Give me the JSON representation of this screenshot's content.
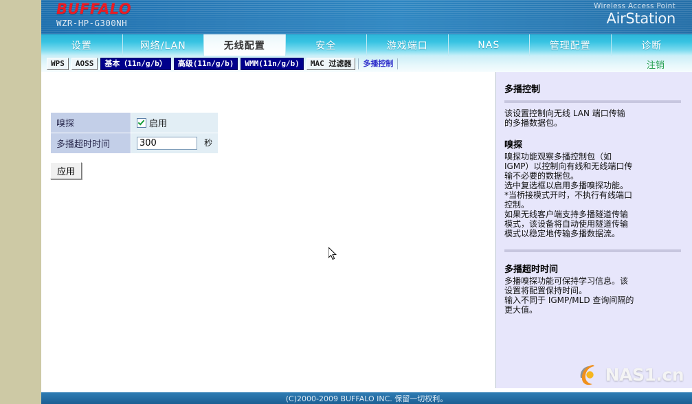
{
  "header": {
    "brand": "BUFFALO",
    "model": "WZR-HP-G300NH",
    "product_sub": "Wireless Access Point",
    "product_name": "AirStation"
  },
  "nav": {
    "tabs": [
      {
        "label": "设置",
        "active": false
      },
      {
        "label": "网络/LAN",
        "active": false
      },
      {
        "label": "无线配置",
        "active": true
      },
      {
        "label": "安全",
        "active": false
      },
      {
        "label": "游戏端口",
        "active": false
      },
      {
        "label": "NAS",
        "active": false
      },
      {
        "label": "管理配置",
        "active": false
      },
      {
        "label": "诊断",
        "active": false
      }
    ]
  },
  "subnav": {
    "tabs": [
      {
        "label": "WPS",
        "style": "plain"
      },
      {
        "label": "AOSS",
        "style": "plain"
      },
      {
        "label": "基本（11n/g/b）",
        "style": "dark"
      },
      {
        "label": "高级(11n/g/b)",
        "style": "dark"
      },
      {
        "label": "WMM(11n/g/b)",
        "style": "dark"
      },
      {
        "label": "MAC 过滤器",
        "style": "plain"
      },
      {
        "label": "多播控制",
        "style": "current"
      }
    ],
    "logout": "注销"
  },
  "form": {
    "rows": [
      {
        "label": "嗅探",
        "type": "checkbox",
        "checked": true,
        "checkbox_label": "启用"
      },
      {
        "label": "多播超时时间",
        "type": "text",
        "value": "300",
        "unit": "秒"
      }
    ],
    "apply_label": "应用"
  },
  "help": {
    "title": "多播控制",
    "intro": "该设置控制向无线 LAN 端口传输\n的多播数据包。",
    "sections": [
      {
        "heading": "嗅探",
        "body": "嗅探功能观察多播控制包（如\nIGMP）以控制向有线和无线端口传\n输不必要的数据包。\n选中复选框以启用多播嗅探功能。\n*当桥接模式开时，不执行有线端口\n控制。\n如果无线客户端支持多播隧道传输\n模式，该设备将自动使用隧道传输\n模式以稳定地传输多播数据流。"
      },
      {
        "heading": "多播超时时间",
        "body": "多播嗅探功能可保持学习信息。该\n设置将配置保持时间。\n输入不同于 IGMP/MLD 查询间隔的\n更大值。"
      }
    ]
  },
  "footer": {
    "copyright": "(C)2000-2009 BUFFALO INC. 保留一切权利。"
  },
  "watermark": {
    "name": "NAS1",
    "tld": ".cn"
  },
  "colors": {
    "page_bg": "#cdc9a5",
    "banner_blue": "#2a7cb8",
    "nav_cyan": "#37c3e2",
    "brand_red": "#ec1c24",
    "logout_green": "#1f9c4a",
    "help_bg": "#e7e6fb",
    "label_cell": "#c3cfe8",
    "value_cell": "#e2eef5",
    "subtab_dark": "#00008b",
    "current_tab_text": "#3333cc"
  }
}
